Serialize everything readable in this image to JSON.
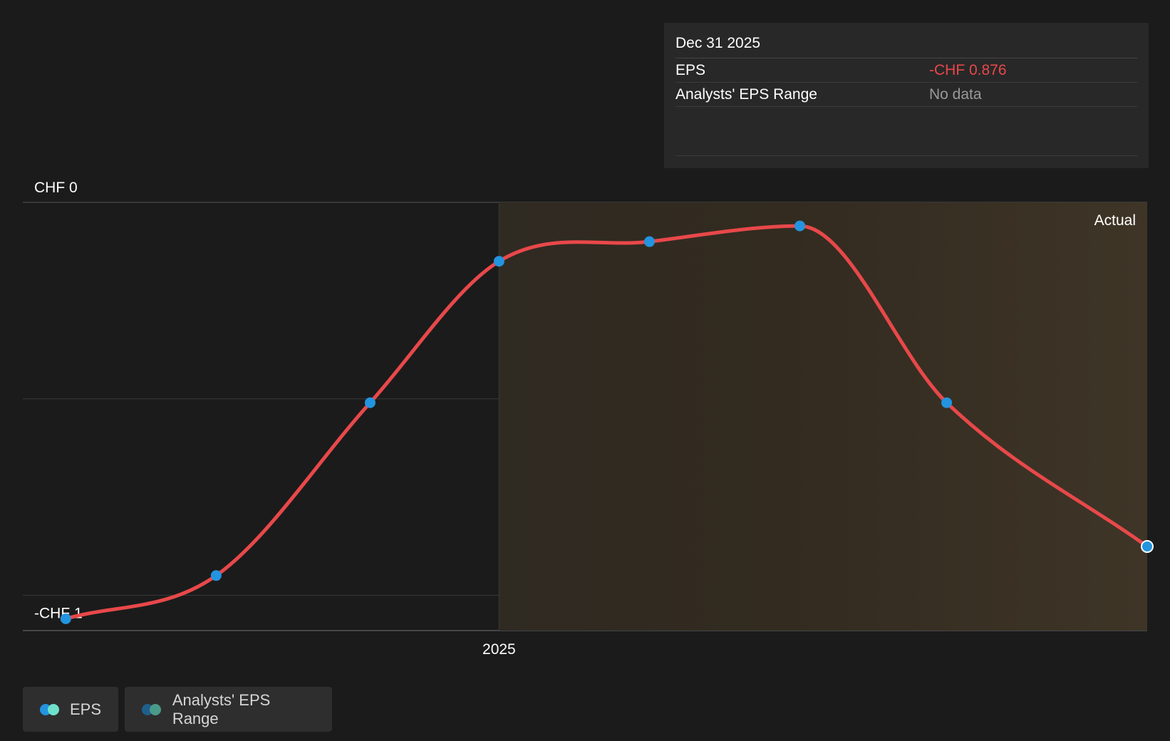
{
  "tooltip": {
    "date": "Dec 31 2025",
    "rows": [
      {
        "label": "EPS",
        "value": "-CHF 0.876"
      },
      {
        "label": "Analysts' EPS Range",
        "value": "No data"
      }
    ]
  },
  "legend": {
    "items": [
      {
        "label": "EPS",
        "colors": [
          "#2394df",
          "#6fe0c9"
        ]
      },
      {
        "label": "Analysts' EPS Range",
        "colors": [
          "#1f5f8b",
          "#4a9a8a"
        ]
      }
    ]
  },
  "colors": {
    "background": "#1b1b1b",
    "line": "#e8484a",
    "point": "#2394df",
    "actual_region": "#3e3527",
    "grid": "#3a3a3a"
  },
  "chart_data": {
    "type": "line",
    "title": "",
    "xlabel": "",
    "ylabel": "",
    "y_tick_labels": [
      "CHF 0",
      "-CHF 1"
    ],
    "y_ticks": [
      0,
      -1
    ],
    "x_tick_labels": [
      "2025"
    ],
    "x_ticks": [
      2025.0
    ],
    "region_label": "Actual",
    "region_start": 2025.0,
    "xlim": [
      2023.67,
      2026.81
    ],
    "ylim": [
      -1.09,
      0.0
    ],
    "grid": true,
    "legend_position": "bottom-left",
    "series": [
      {
        "name": "EPS",
        "x": [
          2023.79,
          2024.21,
          2024.64,
          2025.0,
          2025.42,
          2025.84,
          2026.25,
          2026.81
        ],
        "y": [
          -1.06,
          -0.95,
          -0.51,
          -0.15,
          -0.1,
          -0.06,
          -0.51,
          -0.876
        ]
      }
    ]
  }
}
